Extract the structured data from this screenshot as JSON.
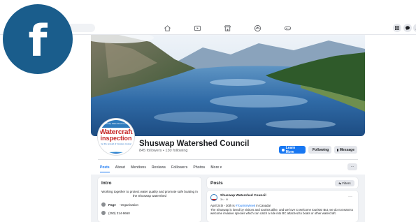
{
  "colors": {
    "accent": "#1877f2",
    "logo_bg": "#1a5d8c",
    "profile_red": "#c62828"
  },
  "logo": {
    "letter": "f",
    "icon": "facebook-logo"
  },
  "nav": {
    "icons": [
      "home-icon",
      "video-icon",
      "marketplace-icon",
      "groups-icon",
      "gaming-icon"
    ],
    "right_icons": [
      "menu-grid-icon",
      "messenger-icon",
      "notifications-icon"
    ]
  },
  "profile_pic": {
    "banner": "Shuswap Watershed Council",
    "title_line1": "Watercraft",
    "title_line2": "inspection",
    "subtitle": "stop the spread of invasive mussels"
  },
  "page": {
    "name": "Shuswap Watershed Council",
    "followers": "845 followers • 130 following"
  },
  "actions": {
    "learn_more": "Learn More",
    "following": "Following",
    "message": "Message"
  },
  "tabs": [
    "Posts",
    "About",
    "Mentions",
    "Reviews",
    "Followers",
    "Photos",
    "More ▾"
  ],
  "more_dots": "···",
  "intro": {
    "heading": "Intro",
    "description": "Working together to protect water quality and promote safe boating in the Shuswap watershed",
    "page_label": "Page",
    "page_category": "· Organisation",
    "phone": "(250) 314-9660"
  },
  "posts": {
    "heading": "Posts",
    "filters": "⇆ Filters",
    "post": {
      "author": "Shuswap Watershed Council",
      "time": "3h · ⊕",
      "date_line_prefix": "April 24th - 30th is ",
      "hashtag": "#TourismWeek",
      "date_line_suffix": " in Canada!",
      "body": "The Shuswap is loved by visitors and tourists alike, and we love to welcome tourists! But, we do not want to welcome invasive species which can catch a ride into BC attached to boats or other watercraft.",
      "dots": "···"
    }
  }
}
